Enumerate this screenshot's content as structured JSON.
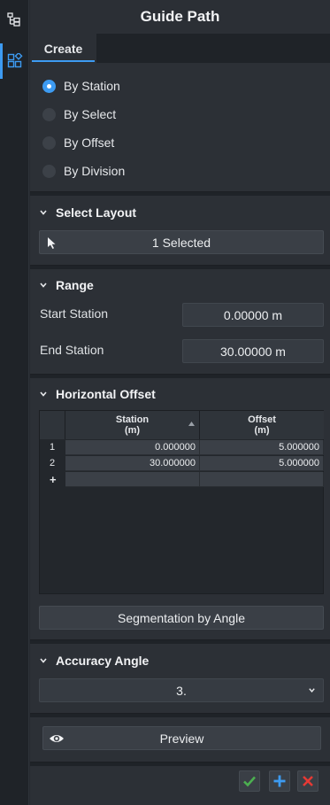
{
  "title": "Guide Path",
  "tabs": [
    {
      "label": "Create",
      "active": true
    }
  ],
  "method": {
    "options": [
      "By Station",
      "By Select",
      "By Offset",
      "By Division"
    ],
    "selected": "By Station"
  },
  "select_layout": {
    "title": "Select Layout",
    "button_label": "1 Selected"
  },
  "range": {
    "title": "Range",
    "start_label": "Start Station",
    "start_value": "0.00000 m",
    "end_label": "End Station",
    "end_value": "30.00000 m"
  },
  "horizontal_offset": {
    "title": "Horizontal Offset",
    "columns": [
      {
        "name": "Station",
        "unit": "(m)"
      },
      {
        "name": "Offset",
        "unit": "(m)"
      }
    ],
    "rows": [
      {
        "num": "1",
        "station": "0.000000",
        "offset": "5.000000"
      },
      {
        "num": "2",
        "station": "30.000000",
        "offset": "5.000000"
      }
    ],
    "add_row_symbol": "+",
    "segmentation_button": "Segmentation by Angle"
  },
  "accuracy_angle": {
    "title": "Accuracy Angle",
    "value": "3."
  },
  "preview_label": "Preview",
  "colors": {
    "accent": "#3d9bf2",
    "ok": "#4caf50",
    "add": "#3d9bf2",
    "cancel": "#e53935"
  }
}
